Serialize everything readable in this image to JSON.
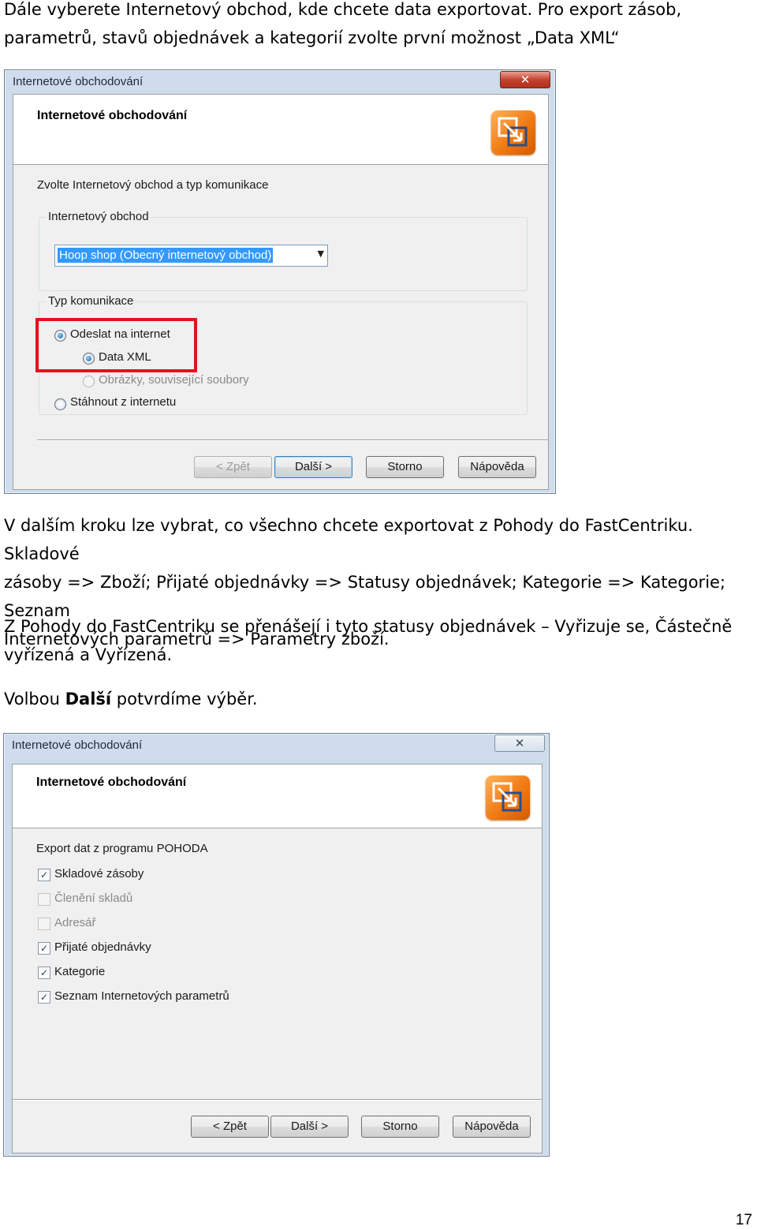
{
  "intro": {
    "line1": "Dále vyberete Internetový obchod, kde chcete data exportovat. Pro export zásob,",
    "line2": "parametrů, stavů objednávek  a kategorií zvolte první možnost „Data XML“"
  },
  "dialog1": {
    "window_title": "Internetové obchodování",
    "close_symbol": "✕",
    "header_title": "Internetové obchodování",
    "section_label": "Zvolte Internetový obchod a typ komunikace",
    "group_shop_label": "Internetový obchod",
    "shop_select_value": "Hoop shop (Obecný internetový obchod)",
    "dropdown_arrow": "▼",
    "group_comm_label": "Typ komunikace",
    "radio_send": "Odeslat na internet",
    "radio_data_xml": "Data XML",
    "radio_images": "Obrázky, související soubory",
    "radio_download": "Stáhnout z internetu",
    "buttons": {
      "back": "< Zpět",
      "next": "Další >",
      "cancel": "Storno",
      "help": "Nápověda"
    }
  },
  "text2": {
    "line1": "V dalším kroku lze vybrat, co všechno chcete exportovat z Pohody do FastCentriku. Skladové",
    "line2": "zásoby => Zboží; Přijaté objednávky => Statusy objednávek; Kategorie => Kategorie; Seznam",
    "line3": "Internetových parametrů => Parametry zboží."
  },
  "text3": {
    "line1": "Z Pohody do FastCentriku se přenášejí i tyto statusy objednávek – Vyřizuje se, Částečně",
    "line2": "vyřízená a Vyřízená."
  },
  "text4": {
    "before": "Volbou ",
    "bold": "Další",
    "after": " potvrdíme výběr."
  },
  "dialog2": {
    "window_title": "Internetové obchodování",
    "close_symbol": "✕",
    "header_title": "Internetové obchodování",
    "section_label": "Export dat z programu POHODA",
    "check_mark": "✓",
    "checkboxes": [
      {
        "label": "Skladové zásoby",
        "checked": true,
        "enabled": true
      },
      {
        "label": "Členění skladů",
        "checked": false,
        "enabled": false
      },
      {
        "label": "Adresář",
        "checked": false,
        "enabled": false
      },
      {
        "label": "Přijaté objednávky",
        "checked": true,
        "enabled": true
      },
      {
        "label": "Kategorie",
        "checked": true,
        "enabled": true
      },
      {
        "label": "Seznam Internetových parametrů",
        "checked": true,
        "enabled": true
      }
    ],
    "buttons": {
      "back": "< Zpět",
      "next": "Další >",
      "cancel": "Storno",
      "help": "Nápověda"
    }
  },
  "page_number": "17",
  "colors": {
    "highlight": "#e0141c",
    "selection": "#3399ff",
    "dialog_frame": "#cfdceb"
  },
  "icons": {
    "app": "pohoda-export-icon"
  }
}
